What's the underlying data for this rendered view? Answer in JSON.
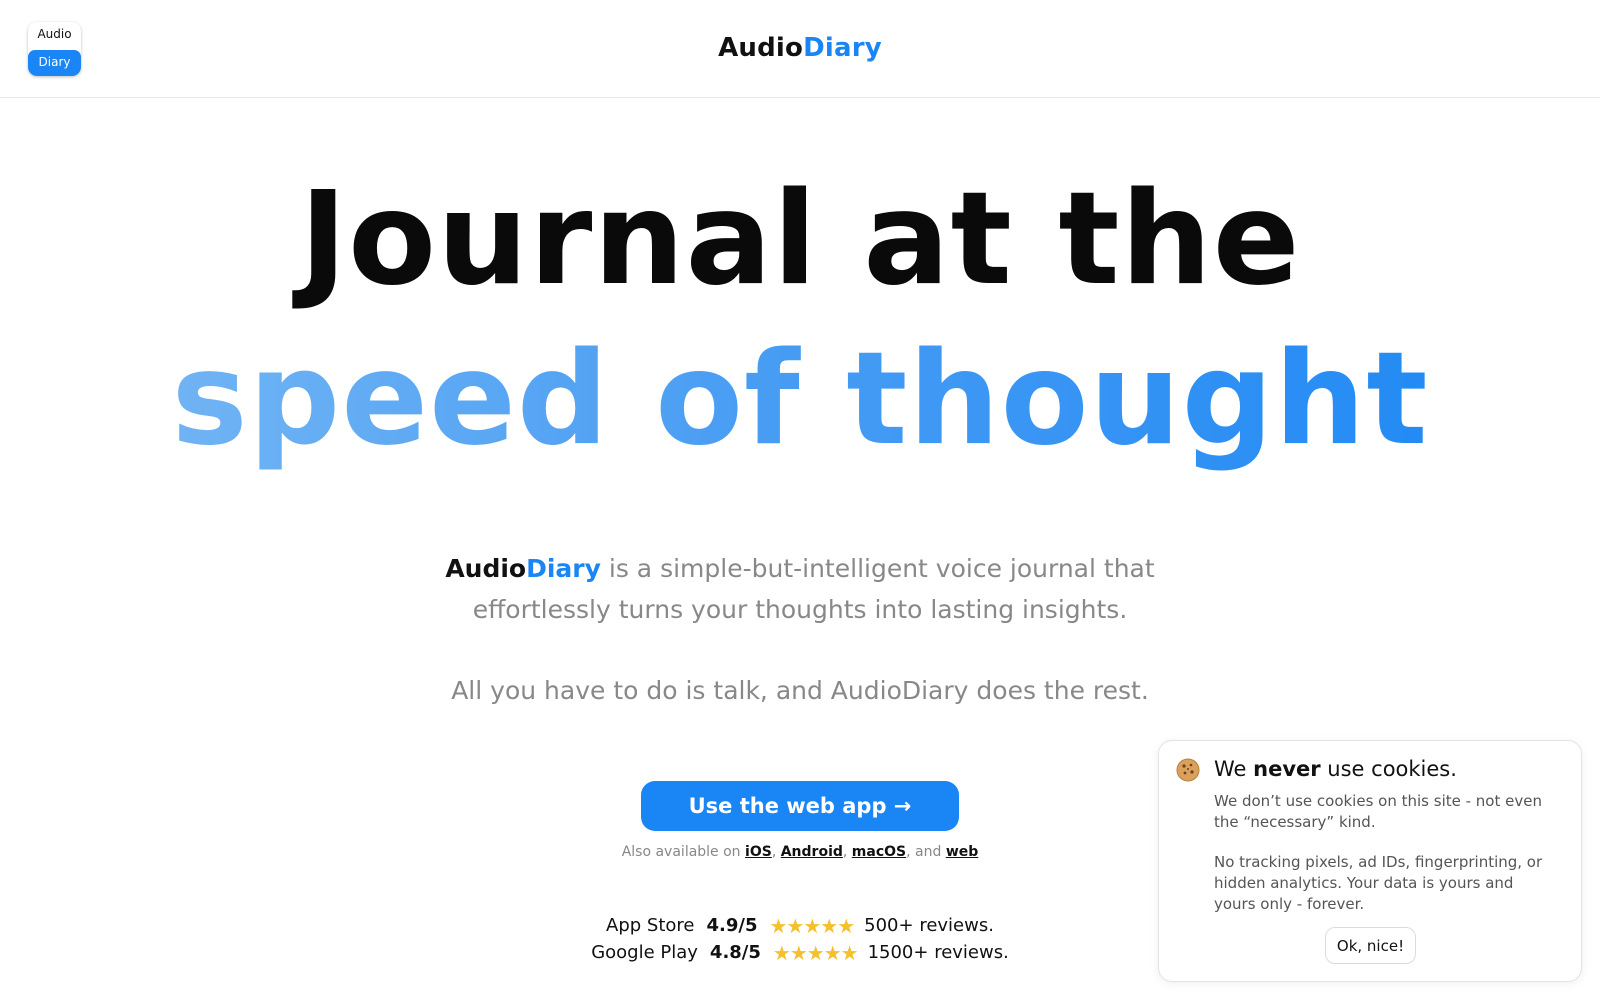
{
  "header": {
    "icon_top": "Audio",
    "icon_bottom": "Diary",
    "brand_part1": "Audio",
    "brand_part2": "Diary"
  },
  "hero": {
    "line1": "Journal at the",
    "line2": "speed of thought"
  },
  "description": {
    "brand_part1": "Audio",
    "brand_part2": "Diary",
    "text_line1": " is a simple-but-intelligent voice journal that",
    "text_line2": "effortlessly turns your thoughts into lasting insights.",
    "tagline": "All you have to do is talk, and AudioDiary does the rest."
  },
  "cta": {
    "label": "Use the web app →"
  },
  "availability": {
    "prefix": "Also available on ",
    "platforms": [
      "iOS",
      "Android",
      "macOS",
      "web"
    ],
    "sep": ", ",
    "and": ", and "
  },
  "ratings": [
    {
      "store": "App Store",
      "score": "4.9/5",
      "stars": "★★★★★",
      "reviews": "500+ reviews."
    },
    {
      "store": "Google Play",
      "score": "4.8/5",
      "stars": "★★★★★",
      "reviews": "1500+ reviews."
    }
  ],
  "cookie_banner": {
    "title_pre": "We ",
    "title_bold": "never",
    "title_post": " use cookies.",
    "paragraph1": "We don’t use cookies on this site - not even the “necessary” kind.",
    "paragraph2": "No tracking pixels, ad IDs, fingerprinting, or hidden analytics. Your data is yours and yours only - forever.",
    "button_label": "Ok, nice!"
  },
  "colors": {
    "accent": "#1a86f5",
    "star": "#f5c02e",
    "muted_text": "#888888"
  }
}
